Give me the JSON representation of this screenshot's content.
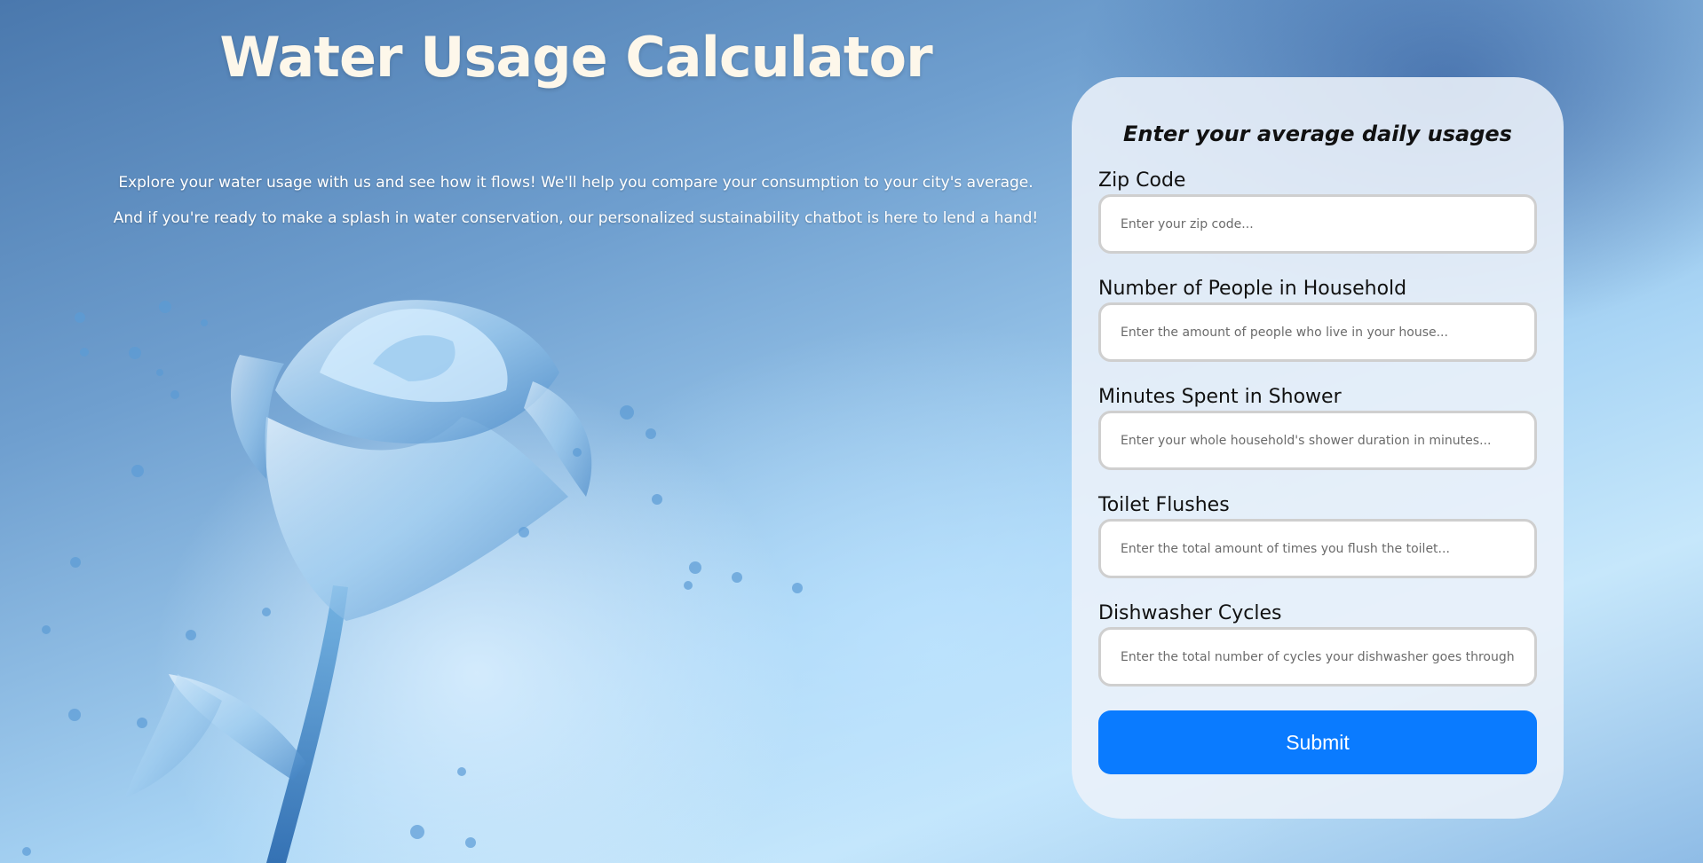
{
  "page": {
    "title": "Water Usage Calculator",
    "intro_lines": [
      "Explore your water usage with us and see how it flows! We'll help you compare your consumption to your city's average.",
      "And if you're ready to make a splash in water conservation, our personalized sustainability chatbot is here to lend a hand!"
    ]
  },
  "form": {
    "heading": "Enter your average daily usages",
    "fields": [
      {
        "label": "Zip Code",
        "value": "",
        "placeholder": "Enter your zip code..."
      },
      {
        "label": "Number of People in Household",
        "value": "",
        "placeholder": "Enter the amount of people who live in your house..."
      },
      {
        "label": "Minutes Spent in Shower",
        "value": "",
        "placeholder": "Enter your whole household's shower duration in minutes..."
      },
      {
        "label": "Toilet Flushes",
        "value": "",
        "placeholder": "Enter the total amount of times you flush the toilet..."
      },
      {
        "label": "Dishwasher Cycles",
        "value": "",
        "placeholder": "Enter the total number of cycles your dishwasher goes through..."
      }
    ],
    "submit_label": "Submit"
  },
  "colors": {
    "accent": "#0a7bff",
    "title_text": "#fdf7ea",
    "card_bg": "#ecf1f9"
  },
  "icons": {
    "background": "water-rose-illustration"
  }
}
